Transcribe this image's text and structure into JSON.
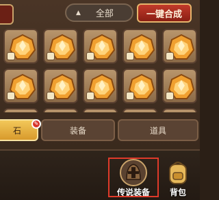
{
  "header": {
    "filter_label": "全部",
    "combine_label": "一键合成"
  },
  "inventory": {
    "rows": 2,
    "cols": 5,
    "visible_partial_row": true,
    "item_icon": "orange-gem-icon"
  },
  "tabs": [
    {
      "label": "石",
      "active": true,
      "badge": ""
    },
    {
      "label": "装备",
      "active": false
    },
    {
      "label": "道具",
      "active": false
    }
  ],
  "bottom_nav": [
    {
      "label": "传说装备",
      "icon": "helmet-icon"
    },
    {
      "label": "背包",
      "icon": "bag-icon"
    }
  ],
  "colors": {
    "highlight": "#e03a2a",
    "active_tab": "#e6b047",
    "combine_button": "#b32e20"
  }
}
